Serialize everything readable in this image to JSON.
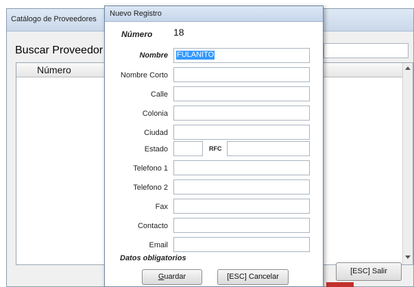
{
  "background_window": {
    "title": "Catálogo de Proveedores",
    "search_label": "Buscar Proveedor",
    "grid": {
      "columns": [
        "Número"
      ]
    },
    "exit_button": "[ESC] Salir"
  },
  "dialog": {
    "title": "Nuevo Registro",
    "numero": {
      "label": "Número",
      "value": "18"
    },
    "fields": [
      {
        "label": "Nombre",
        "value": "FULANITO",
        "required": true
      },
      {
        "label": "Nombre Corto",
        "value": ""
      },
      {
        "label": "Calle",
        "value": ""
      },
      {
        "label": "Colonia",
        "value": ""
      },
      {
        "label": "Ciudad",
        "value": ""
      }
    ],
    "estado": {
      "label": "Estado",
      "value": ""
    },
    "rfc": {
      "label": "RFC",
      "value": ""
    },
    "fields2": [
      {
        "label": "Telefono 1",
        "value": ""
      },
      {
        "label": "Telefono 2",
        "value": ""
      },
      {
        "label": "Fax",
        "value": ""
      },
      {
        "label": "Contacto",
        "value": ""
      },
      {
        "label": "Email",
        "value": ""
      }
    ],
    "required_note": "Datos obligatorios",
    "save_button": {
      "accel": "G",
      "rest": "uardar"
    },
    "cancel_button": "[ESC] Cancelar"
  }
}
